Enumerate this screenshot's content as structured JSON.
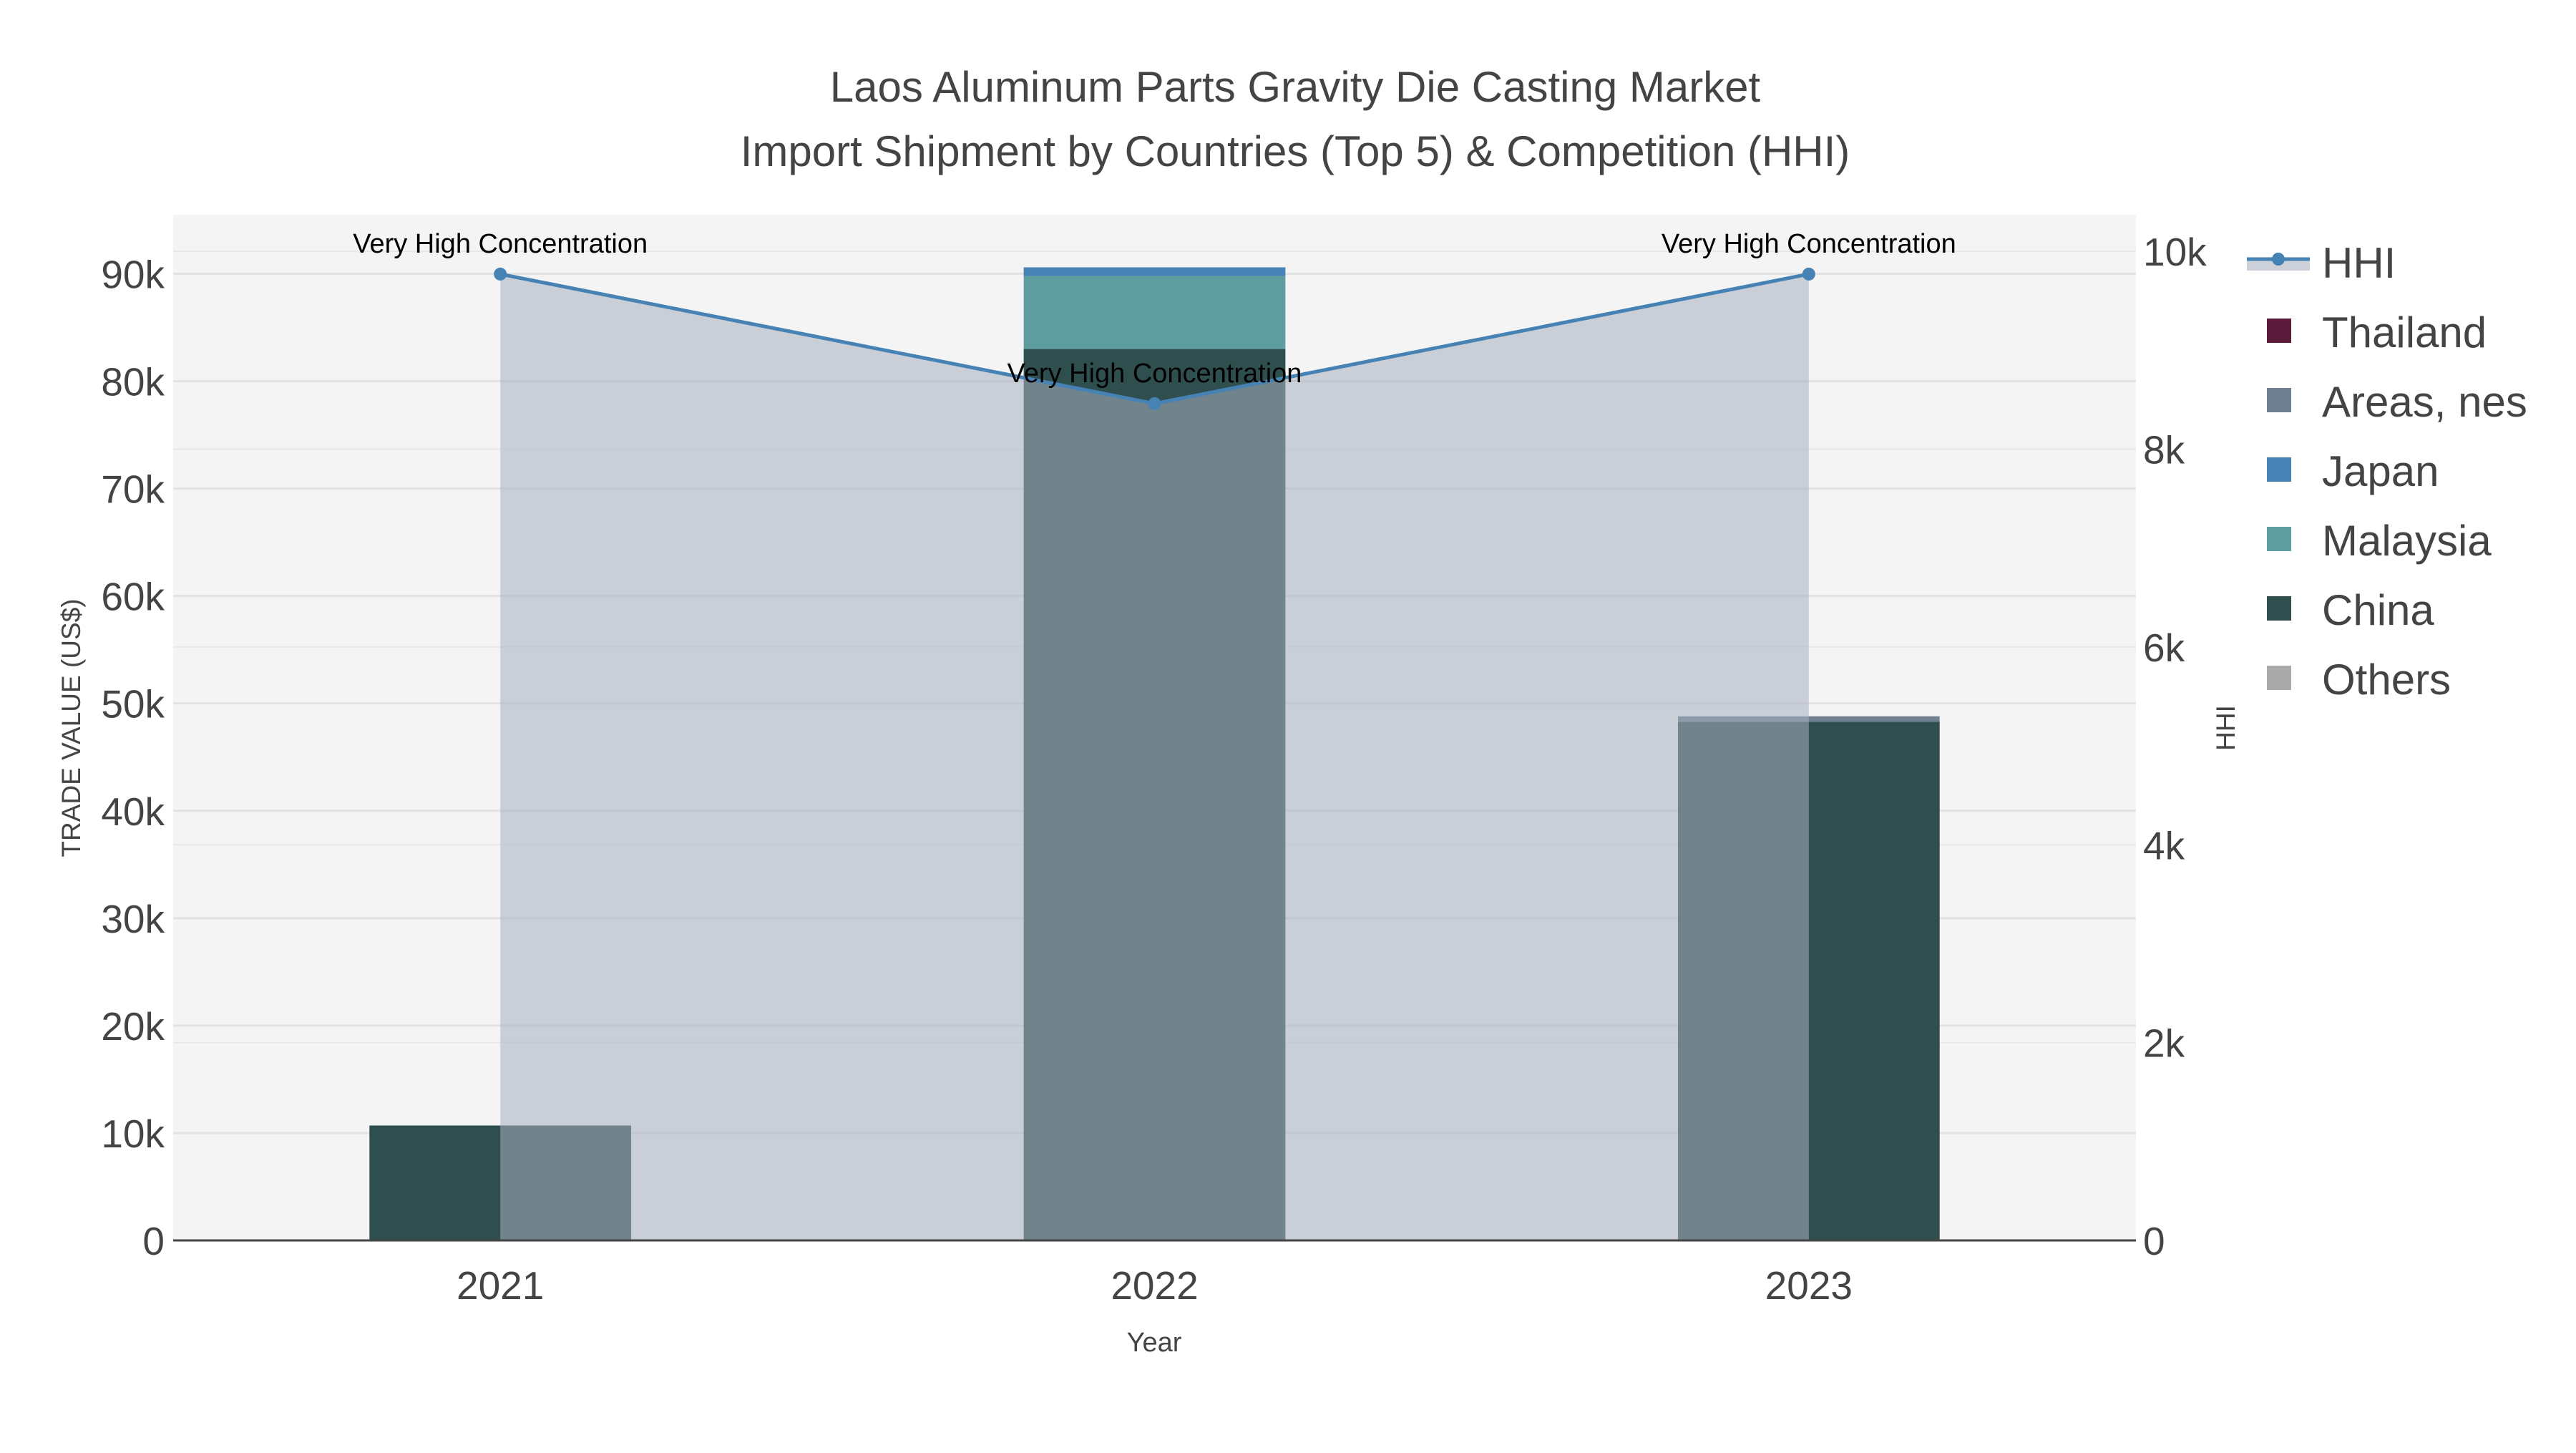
{
  "chart_data": {
    "type": "bar",
    "title": "Laos Aluminum Parts Gravity Die Casting Market",
    "subtitle": "Import Shipment by Countries (Top 5) & Competition (HHI)",
    "xlabel": "Year",
    "ylabel": "TRADE VALUE (US$)",
    "y2label": "HHI",
    "categories": [
      "2021",
      "2022",
      "2023"
    ],
    "ylim": [
      0,
      95500
    ],
    "y2lim": [
      0,
      10370
    ],
    "yticks": [
      0,
      10000,
      20000,
      30000,
      40000,
      50000,
      60000,
      70000,
      80000,
      90000
    ],
    "ytick_labels": [
      "0",
      "10k",
      "20k",
      "30k",
      "40k",
      "50k",
      "60k",
      "70k",
      "80k",
      "90k"
    ],
    "y2ticks": [
      0,
      2000,
      4000,
      6000,
      8000,
      10000
    ],
    "y2tick_labels": [
      "0",
      "2k",
      "4k",
      "6k",
      "8k",
      "10k"
    ],
    "grid": true,
    "legend_placement": "right",
    "series": [
      {
        "name": "Thailand",
        "color": "#5c1a3a",
        "values": [
          0,
          0,
          0
        ]
      },
      {
        "name": "Areas, nes",
        "color": "#708090",
        "values": [
          0,
          0,
          500
        ]
      },
      {
        "name": "Japan",
        "color": "#4682b4",
        "values": [
          0,
          800,
          0
        ]
      },
      {
        "name": "Malaysia",
        "color": "#5f9ea0",
        "values": [
          0,
          6800,
          0
        ]
      },
      {
        "name": "China",
        "color": "#2f4f4f",
        "values": [
          10700,
          83000,
          48300
        ]
      },
      {
        "name": "Others",
        "color": "#aaaaaa",
        "values": [
          0,
          0,
          0
        ]
      }
    ],
    "stack_order": [
      "China",
      "Malaysia",
      "Japan",
      "Areas, nes",
      "Thailand",
      "Others"
    ],
    "hhi": {
      "name": "HHI",
      "color": "#4682b4",
      "values": [
        9770,
        8460,
        9770
      ],
      "annotations": [
        "Very High Concentration",
        "Very High Concentration",
        "Very High Concentration"
      ]
    },
    "legend": [
      "HHI",
      "Thailand",
      "Areas, nes",
      "Japan",
      "Malaysia",
      "China",
      "Others"
    ]
  }
}
